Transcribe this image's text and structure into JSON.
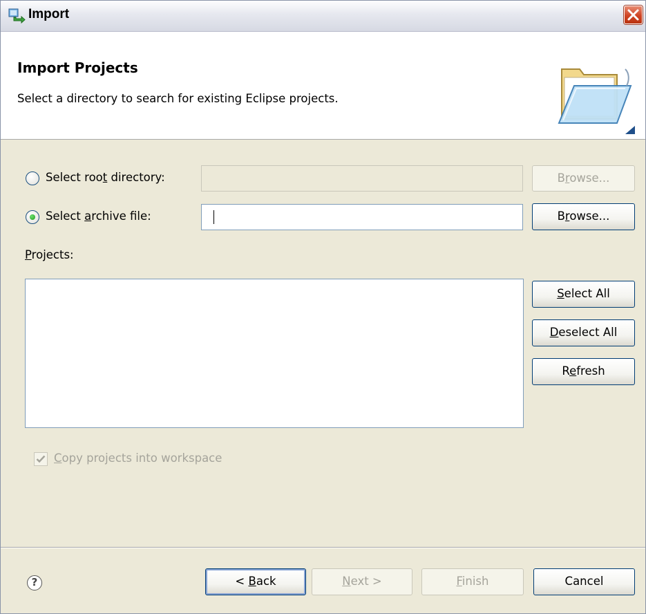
{
  "window": {
    "title": "Import",
    "close_icon": "close-icon"
  },
  "header": {
    "title": "Import Projects",
    "description": "Select a directory to search for existing Eclipse projects.",
    "icon": "open-folder-icon"
  },
  "source": {
    "root_directory": {
      "label_pre": "Select roo",
      "label_mnemonic": "t",
      "label_post": " directory:",
      "selected": false,
      "value": "",
      "browse_pre": "B",
      "browse_mnemonic": "r",
      "browse_post": "owse..."
    },
    "archive_file": {
      "label_pre": "Select ",
      "label_mnemonic": "a",
      "label_post": "rchive file:",
      "selected": true,
      "value": "",
      "browse_pre": "B",
      "browse_mnemonic": "r",
      "browse_post": "owse..."
    }
  },
  "projects": {
    "label_mnemonic": "P",
    "label_post": "rojects:",
    "items": [],
    "select_all": {
      "mnemonic": "S",
      "post": "elect All"
    },
    "deselect_all": {
      "mnemonic": "D",
      "post": "eselect All"
    },
    "refresh": {
      "pre": "R",
      "mnemonic": "e",
      "post": "fresh"
    }
  },
  "copy_option": {
    "mnemonic": "C",
    "post": "opy projects into workspace",
    "checked": true,
    "enabled": false
  },
  "footer": {
    "help_icon": "help-icon",
    "back": {
      "pre": "< ",
      "mnemonic": "B",
      "post": "ack"
    },
    "next": {
      "mnemonic": "N",
      "post": "ext >"
    },
    "finish": {
      "mnemonic": "F",
      "post": "inish"
    },
    "cancel": "Cancel"
  },
  "colors": {
    "accent": "#003c74",
    "disabled_text": "#a5a49b",
    "dialog_bg": "#ece9d8"
  }
}
